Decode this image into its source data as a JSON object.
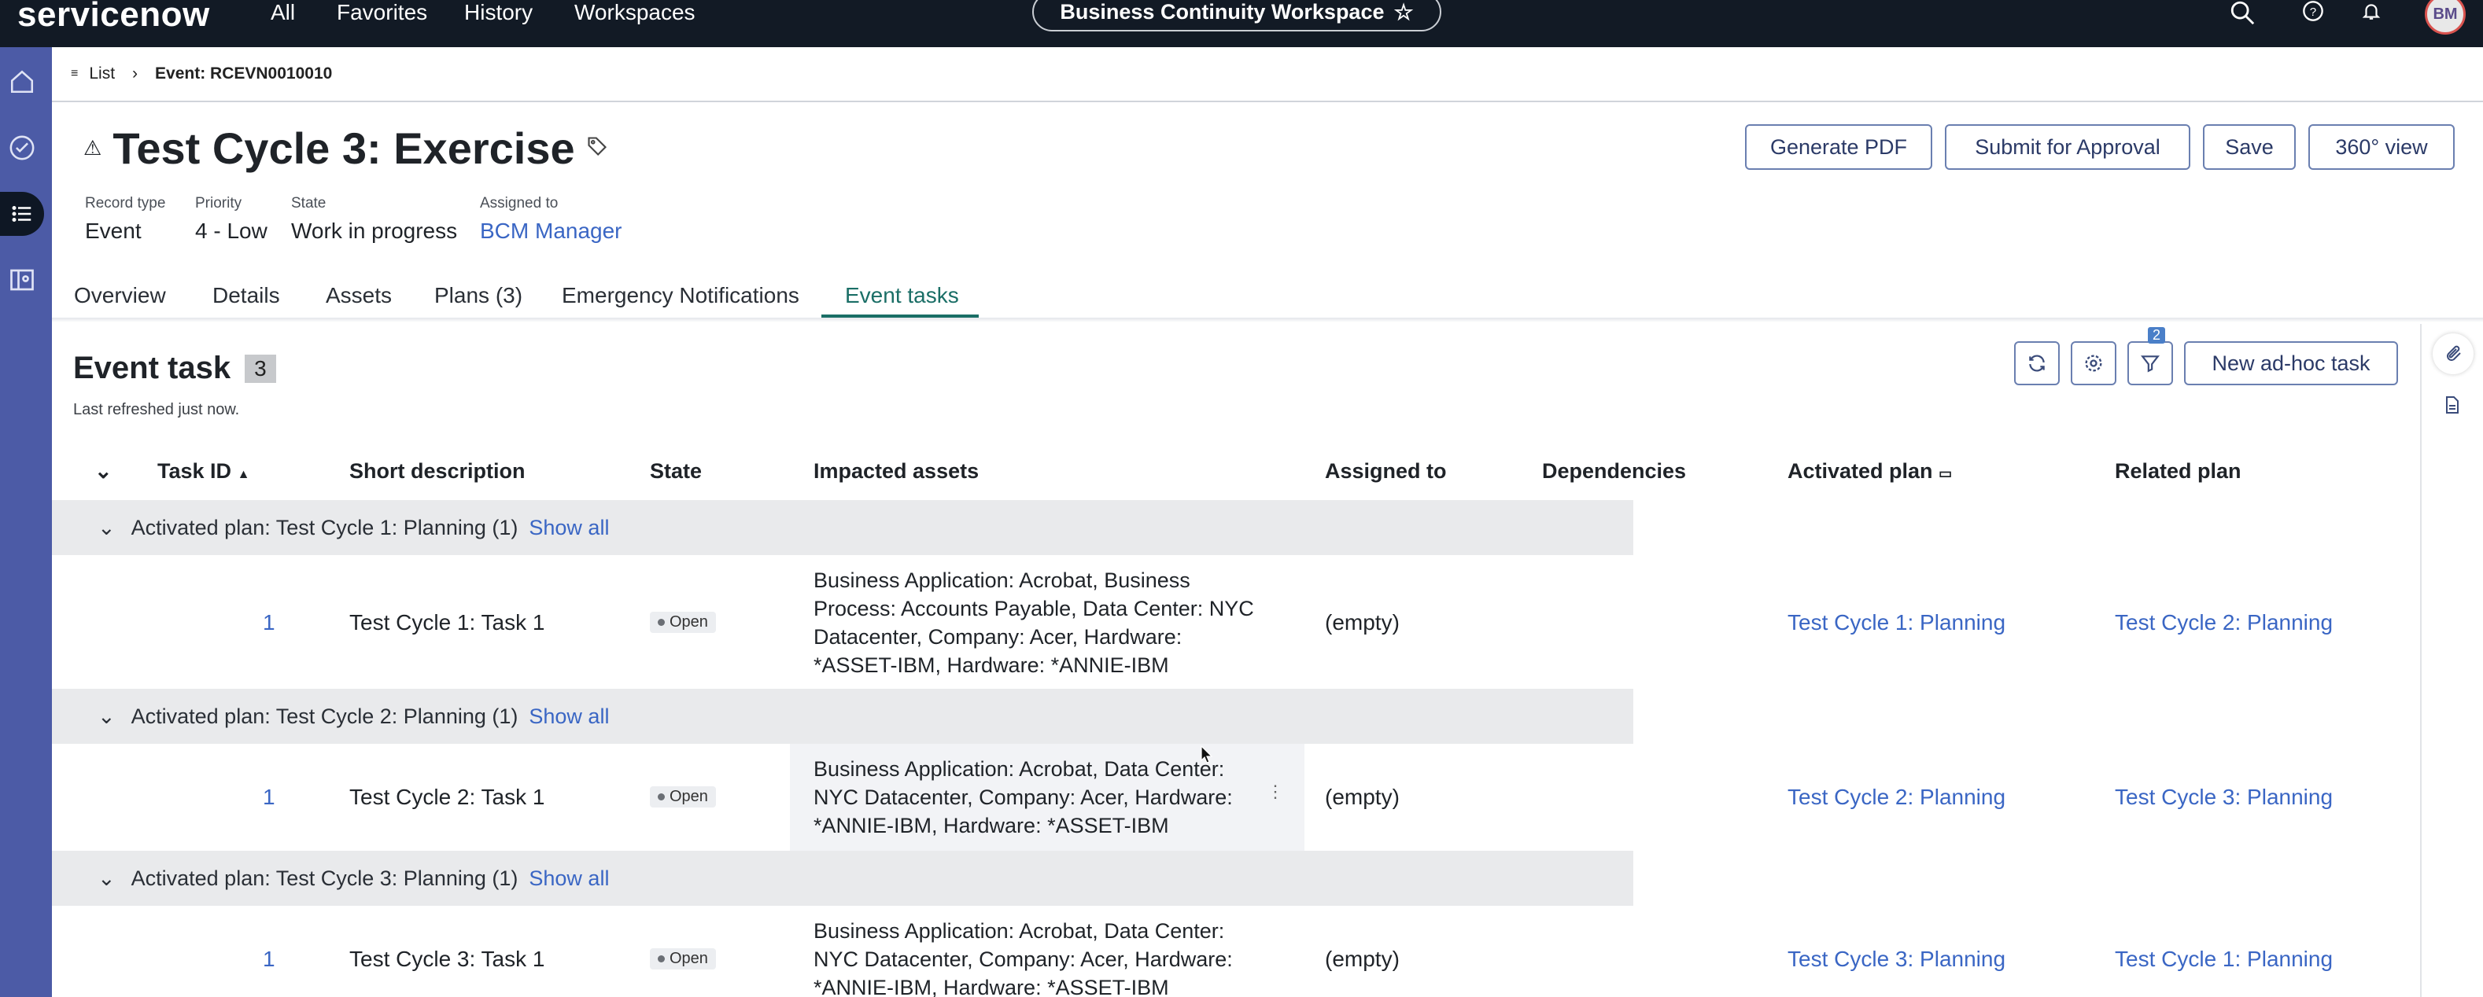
{
  "topnav": {
    "logo": "servicenow",
    "links": [
      "All",
      "Favorites",
      "History",
      "Workspaces"
    ],
    "workspace": "Business Continuity Workspace",
    "avatar_initials": "BM",
    "icons": [
      "search-icon",
      "help-icon",
      "bell-icon"
    ]
  },
  "breadcrumb": {
    "list_label": "List",
    "current": "Event: RCEVN0010010"
  },
  "header": {
    "title": "Test Cycle 3: Exercise",
    "buttons": {
      "generate_pdf": "Generate PDF",
      "submit": "Submit for Approval",
      "save": "Save",
      "view360": "360° view"
    },
    "meta": {
      "record_type_label": "Record type",
      "record_type": "Event",
      "priority_label": "Priority",
      "priority": "4 - Low",
      "state_label": "State",
      "state": "Work in progress",
      "assigned_label": "Assigned to",
      "assigned": "BCM Manager"
    }
  },
  "tabs": [
    "Overview",
    "Details",
    "Assets",
    "Plans (3)",
    "Emergency Notifications",
    "Event tasks"
  ],
  "list": {
    "title": "Event task",
    "count": "3",
    "refreshed": "Last refreshed just now.",
    "filter_count": "2",
    "adhoc": "New ad-hoc task",
    "columns": [
      "Task ID",
      "Short description",
      "State",
      "Impacted assets",
      "Assigned to",
      "Dependencies",
      "Activated plan",
      "Related plan"
    ],
    "show_all": "Show all",
    "groups": [
      {
        "label": "Activated plan: Test Cycle 1: Planning (1)",
        "row": {
          "id": "1",
          "desc": "Test Cycle 1: Task 1",
          "state": "Open",
          "assets": "Business Application: Acrobat, Business Process: Accounts Payable, Data Center: NYC Datacenter, Company: Acer, Hardware: *ASSET-IBM, Hardware: *ANNIE-IBM",
          "assigned": "(empty)",
          "activated": "Test Cycle 1: Planning",
          "related": "Test Cycle 2: Planning"
        }
      },
      {
        "label": "Activated plan: Test Cycle 2: Planning (1)",
        "row": {
          "id": "1",
          "desc": "Test Cycle 2: Task 1",
          "state": "Open",
          "assets": "Business Application: Acrobat, Data Center: NYC Datacenter, Company: Acer, Hardware: *ANNIE-IBM, Hardware: *ASSET-IBM",
          "assigned": "(empty)",
          "activated": "Test Cycle 2: Planning",
          "related": "Test Cycle 3: Planning"
        }
      },
      {
        "label": "Activated plan: Test Cycle 3: Planning (1)",
        "row": {
          "id": "1",
          "desc": "Test Cycle 3: Task 1",
          "state": "Open",
          "assets": "Business Application: Acrobat, Data Center: NYC Datacenter, Company: Acer, Hardware: *ANNIE-IBM, Hardware: *ASSET-IBM",
          "assigned": "(empty)",
          "activated": "Test Cycle 3: Planning",
          "related": "Test Cycle 1: Planning"
        }
      }
    ]
  },
  "colors": {
    "topnav": "#121a25",
    "rail": "#4c5ba6",
    "link": "#3a66c4",
    "active_tab": "#1a6e66",
    "group_bg": "#e9eaec"
  }
}
